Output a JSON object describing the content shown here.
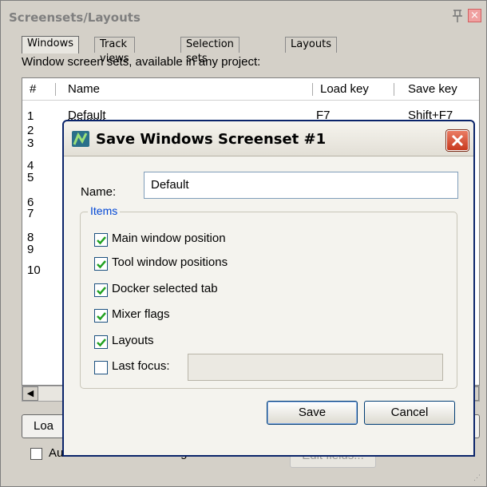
{
  "panel": {
    "title": "Screensets/Layouts",
    "tabs": [
      {
        "label": "Windows"
      },
      {
        "label": "Track views"
      },
      {
        "label": "Selection sets"
      },
      {
        "label": "Layouts"
      }
    ],
    "description": "Window screen sets, available in any project:",
    "columns": {
      "num": "#",
      "name": "Name",
      "load_key": "Load key",
      "save_key": "Save key"
    },
    "rows": [
      {
        "num": "1",
        "name": "Default",
        "load_key": "F7",
        "save_key": "Shift+F7"
      },
      {
        "num": "2"
      },
      {
        "num": "3"
      },
      {
        "num": "4"
      },
      {
        "num": "5"
      },
      {
        "num": "6"
      },
      {
        "num": "7"
      },
      {
        "num": "8"
      },
      {
        "num": "9"
      },
      {
        "num": "10"
      }
    ],
    "load_button_partial": "Loa",
    "autosave_label": "Auto-save when switching screensets",
    "autosave_checked": false,
    "edit_fields_label": "Edit fields..."
  },
  "dialog": {
    "title": "Save Windows Screenset #1",
    "name_label": "Name:",
    "name_value": "Default",
    "items_legend": "Items",
    "checkboxes": [
      {
        "label": "Main window position",
        "checked": true
      },
      {
        "label": "Tool window positions",
        "checked": true
      },
      {
        "label": "Docker selected tab",
        "checked": true
      },
      {
        "label": "Mixer flags",
        "checked": true
      },
      {
        "label": "Layouts",
        "checked": true
      },
      {
        "label": "Last focus:",
        "checked": false
      }
    ],
    "save_label": "Save",
    "cancel_label": "Cancel"
  },
  "colors": {
    "accent": "#0046d5",
    "close_red": "#c83a1f",
    "check_green": "#21a121"
  },
  "icons": {
    "pin": "pin-icon",
    "close": "close-icon",
    "app": "reaper-app-icon",
    "check": "check-icon"
  }
}
